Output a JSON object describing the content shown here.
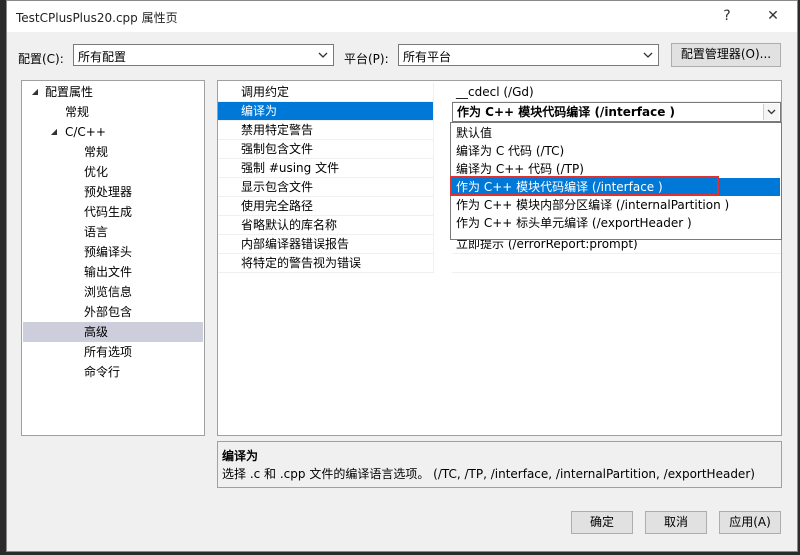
{
  "window": {
    "title": "TestCPlusPlus20.cpp 属性页",
    "help_button": "?",
    "close_button": "✕"
  },
  "config_bar": {
    "config_label": "配置(C):",
    "config_value": "所有配置",
    "platform_label": "平台(P):",
    "platform_value": "所有平台",
    "config_manager_button": "配置管理器(O)..."
  },
  "tree": {
    "items": [
      {
        "label": "配置属性",
        "caret": "◢"
      },
      {
        "label": "常规"
      },
      {
        "label": "C/C++",
        "caret": "◢"
      },
      {
        "label": "常规"
      },
      {
        "label": "优化"
      },
      {
        "label": "预处理器"
      },
      {
        "label": "代码生成"
      },
      {
        "label": "语言"
      },
      {
        "label": "预编译头"
      },
      {
        "label": "输出文件"
      },
      {
        "label": "浏览信息"
      },
      {
        "label": "外部包含"
      },
      {
        "label": "高级"
      },
      {
        "label": "所有选项"
      },
      {
        "label": "命令行"
      }
    ]
  },
  "properties": [
    {
      "name": "调用约定",
      "value": "__cdecl (/Gd)"
    },
    {
      "name": "编译为",
      "value": "作为 C++ 模块代码编译 (/interface )"
    },
    {
      "name": "禁用特定警告",
      "value": ""
    },
    {
      "name": "强制包含文件",
      "value": ""
    },
    {
      "name": "强制 #using 文件",
      "value": ""
    },
    {
      "name": "显示包含文件",
      "value": ""
    },
    {
      "name": "使用完全路径",
      "value": ""
    },
    {
      "name": "省略默认的库名称",
      "value": ""
    },
    {
      "name": "内部编译器错误报告",
      "value": "立即提示 (/errorReport:prompt)"
    },
    {
      "name": "将特定的警告视为错误",
      "value": ""
    }
  ],
  "dropdown": {
    "options": [
      "默认值",
      "编译为 C 代码 (/TC)",
      "编译为 C++ 代码 (/TP)",
      "作为 C++ 模块代码编译 (/interface )",
      "作为 C++ 模块内部分区编译 (/internalPartition )",
      "作为 C++ 标头单元编译 (/exportHeader )"
    ],
    "selected_index": 3
  },
  "description": {
    "title": "编译为",
    "text": "选择 .c 和 .cpp 文件的编译语言选项。      (/TC, /TP, /interface, /internalPartition, /exportHeader)"
  },
  "buttons": {
    "ok": "确定",
    "cancel": "取消",
    "apply": "应用(A)"
  },
  "colors": {
    "selection": "#0078d7",
    "highlight_box": "#e03030",
    "tree_selected": "#cccedb"
  }
}
